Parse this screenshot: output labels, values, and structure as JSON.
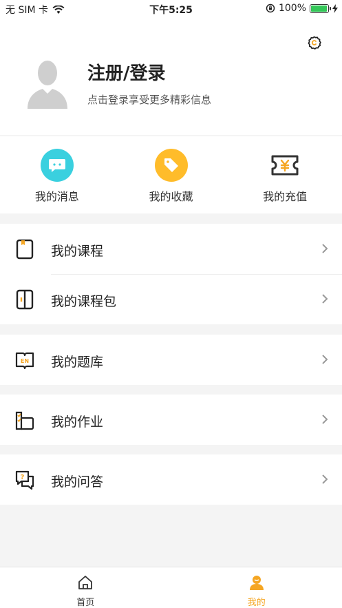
{
  "status_bar": {
    "carrier": "无 SIM 卡",
    "time": "下午5:25",
    "battery_text": "100%",
    "battery_level": 1.0
  },
  "profile": {
    "title": "注册/登录",
    "subtitle": "点击登录享受更多精彩信息"
  },
  "quick_actions": [
    {
      "label": "我的消息",
      "color": "#3ad0df"
    },
    {
      "label": "我的收藏",
      "color": "#ffbc2a"
    },
    {
      "label": "我的充值",
      "color": "#333333"
    }
  ],
  "menu": {
    "courses": "我的课程",
    "course_packages": "我的课程包",
    "question_bank": "我的题库",
    "homework": "我的作业",
    "qa": "我的问答"
  },
  "tabs": {
    "home": "首页",
    "mine": "我的"
  },
  "colors": {
    "accent": "#f5a623",
    "inactive": "#333333"
  }
}
